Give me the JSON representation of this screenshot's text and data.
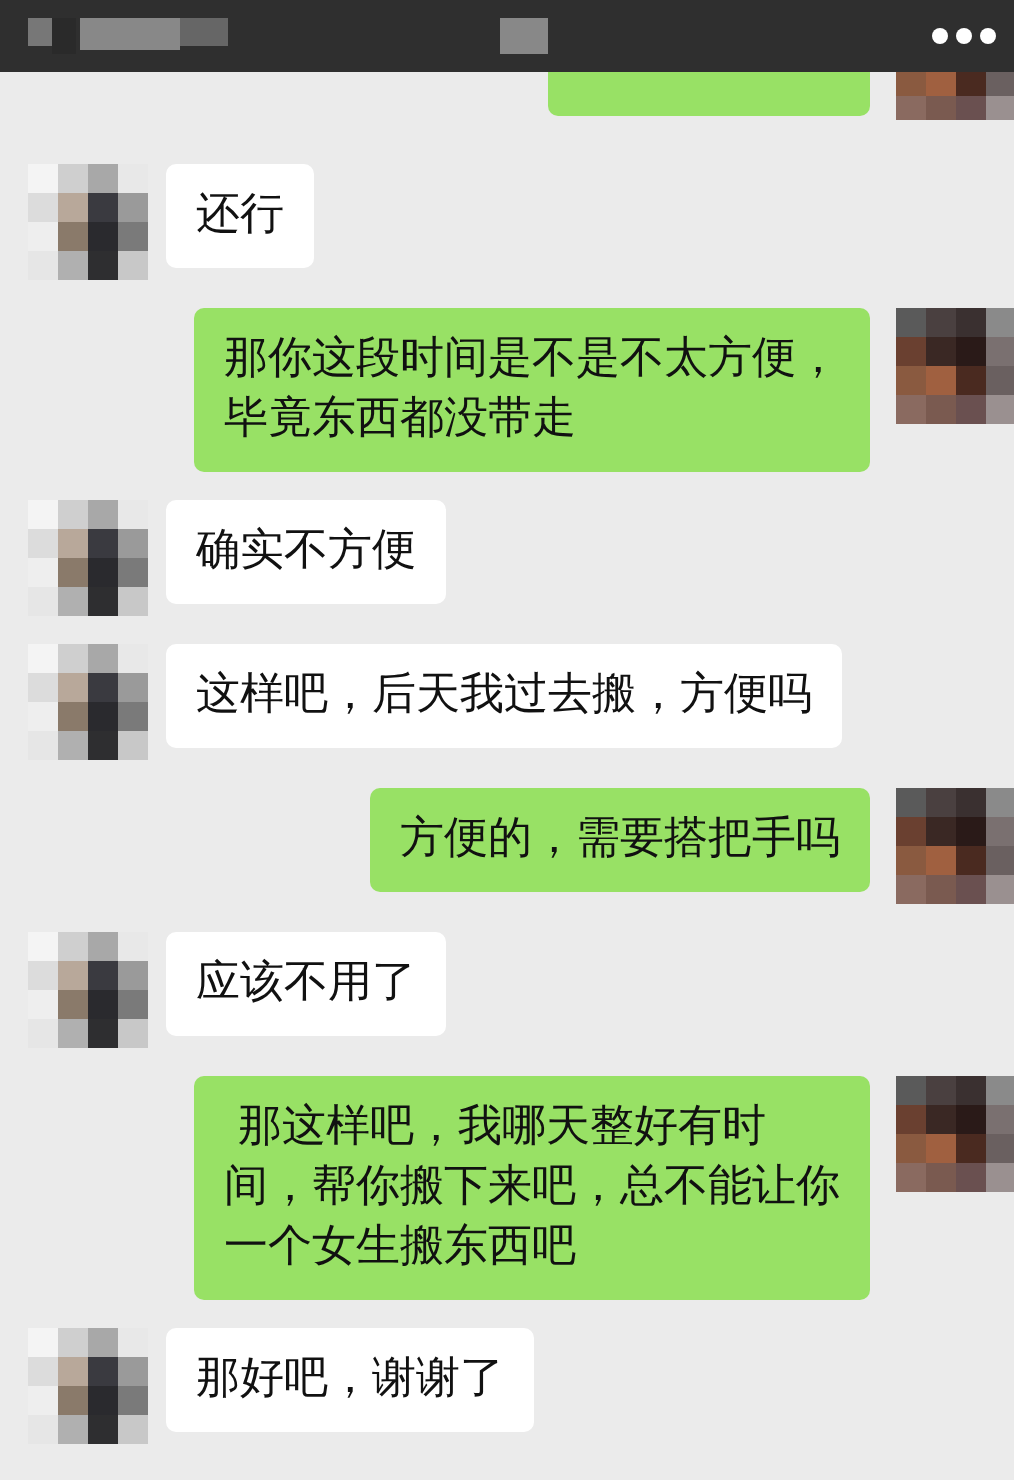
{
  "hidden_message": {
    "kind": "outgoing"
  },
  "messages": [
    {
      "kind": "incoming",
      "lines": [
        "还行"
      ]
    },
    {
      "kind": "outgoing",
      "lines": [
        "那你这段时间是不是不太方便，",
        "毕竟东西都没带走"
      ]
    },
    {
      "kind": "incoming",
      "lines": [
        "确实不方便"
      ]
    },
    {
      "kind": "incoming",
      "lines": [
        "这样吧，后天我过去搬，方便吗"
      ]
    },
    {
      "kind": "outgoing",
      "lines": [
        "方便的，需要搭把手吗"
      ]
    },
    {
      "kind": "incoming",
      "lines": [
        "应该不用了"
      ]
    },
    {
      "kind": "outgoing",
      "lines": [
        " 那这样吧，我哪天整好有时",
        "间，帮你搬下来吧，总不能让你",
        "一个女生搬东西吧"
      ]
    },
    {
      "kind": "incoming",
      "lines": [
        "那好吧，谢谢了"
      ]
    }
  ]
}
